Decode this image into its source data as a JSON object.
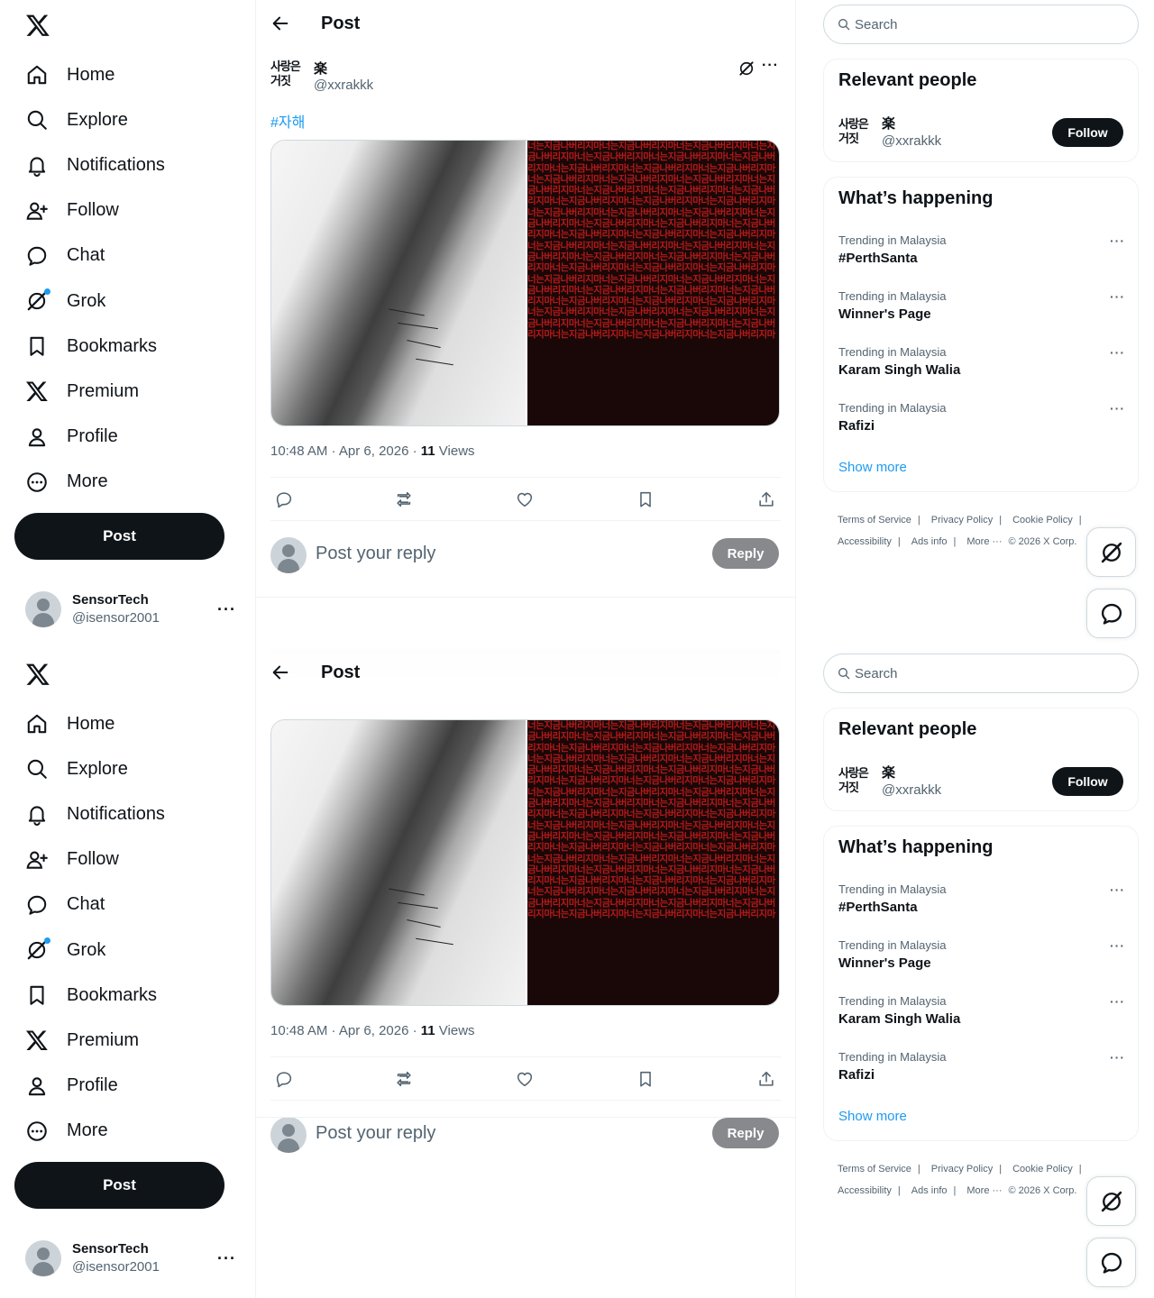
{
  "nav": {
    "items": [
      {
        "label": "Home",
        "icon": "home-icon"
      },
      {
        "label": "Explore",
        "icon": "search-icon"
      },
      {
        "label": "Notifications",
        "icon": "bell-icon"
      },
      {
        "label": "Follow",
        "icon": "person-plus-icon"
      },
      {
        "label": "Chat",
        "icon": "chat-bubble-icon"
      },
      {
        "label": "Grok",
        "icon": "grok-icon"
      },
      {
        "label": "Bookmarks",
        "icon": "bookmark-icon"
      },
      {
        "label": "Premium",
        "icon": "x-logo-icon"
      },
      {
        "label": "Profile",
        "icon": "person-icon"
      },
      {
        "label": "More",
        "icon": "more-circle-icon"
      }
    ],
    "post_button": "Post",
    "account": {
      "name": "SensorTech",
      "handle": "@isensor2001",
      "more": "···"
    }
  },
  "header": {
    "title": "Post"
  },
  "post": {
    "avatar_text": "사랑은\n거짓",
    "name": "楽",
    "handle": "@xxrakkk",
    "more": "···",
    "hashtag": "#자해",
    "media_text": "너는지금나버리지마너는지금나버리지마",
    "time": "10:48 AM · Apr 6, 2026 · ",
    "views_count": "11",
    "views_label": " Views",
    "actions": [
      "reply-icon",
      "repost-icon",
      "like-icon",
      "bookmark-icon",
      "share-icon"
    ]
  },
  "reply": {
    "placeholder": "Post your reply",
    "button": "Reply"
  },
  "search": {
    "placeholder": "Search"
  },
  "relevant_people": {
    "title": "Relevant people",
    "name": "楽",
    "handle": "@xxrakkk",
    "follow": "Follow"
  },
  "whats_happening": {
    "title": "What’s happening",
    "trends": [
      {
        "context": "Trending in Malaysia",
        "name": "#PerthSanta"
      },
      {
        "context": "Trending in Malaysia",
        "name": "Winner's Page"
      },
      {
        "context": "Trending in Malaysia",
        "name": "Karam Singh Walia"
      },
      {
        "context": "Trending in Malaysia",
        "name": "Rafizi"
      }
    ],
    "show_more": "Show more",
    "more": "···"
  },
  "footer": {
    "links": [
      "Terms of Service",
      "Privacy Policy",
      "Cookie Policy",
      "Accessibility",
      "Ads info",
      "More ···",
      "© 2026 X Corp."
    ]
  },
  "colors": {
    "accent": "#1d9bf0",
    "text": "#0f1419",
    "muted": "#536471",
    "button_dark": "#0f1419",
    "reply_disabled": "#87898c"
  }
}
